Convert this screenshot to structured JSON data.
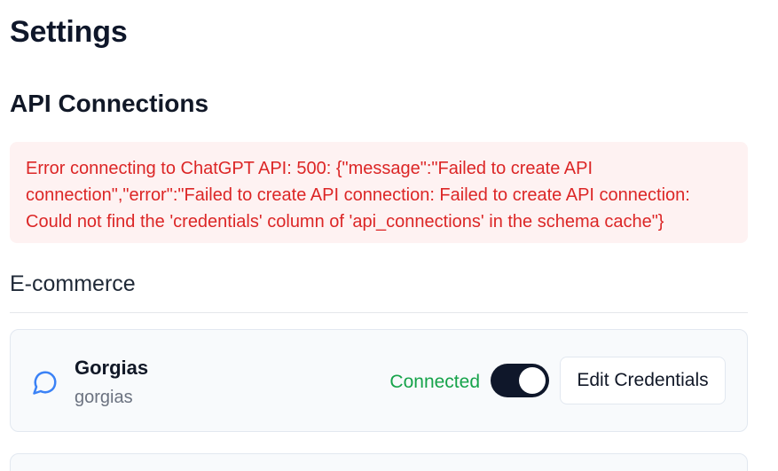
{
  "page": {
    "title": "Settings"
  },
  "api_connections": {
    "title": "API Connections",
    "error_message": "Error connecting to ChatGPT API: 500: {\"message\":\"Failed to create API connection\",\"error\":\"Failed to create API connection: Failed to create API connection: Could not find the 'credentials' column of 'api_connections' in the schema cache\"}"
  },
  "ecommerce": {
    "title": "E-commerce",
    "integrations": [
      {
        "name": "Gorgias",
        "slug": "gorgias",
        "icon": "chat-bubble-icon",
        "status": "Connected",
        "enabled": true,
        "edit_label": "Edit Credentials"
      }
    ]
  },
  "colors": {
    "error_text": "#dc2626",
    "error_bg": "#fef2f2",
    "connected": "#16a34a",
    "toggle_on": "#0f172a",
    "icon_accent": "#3b82f6"
  }
}
